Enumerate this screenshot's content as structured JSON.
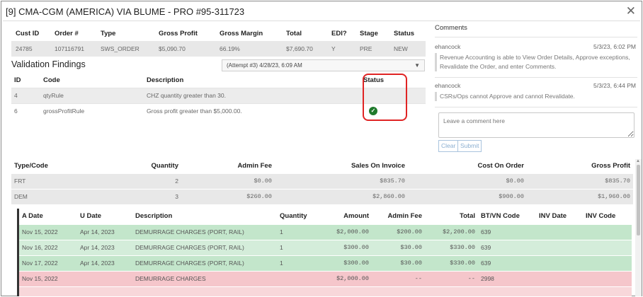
{
  "title": "[9] CMA-CGM (AMERICA) VIA BLUME - PRO #95-311723",
  "close_glyph": "✕",
  "order": {
    "headers": [
      "Cust ID",
      "Order #",
      "Type",
      "Gross Profit",
      "Gross Margin",
      "Total",
      "EDI?",
      "Stage",
      "Status"
    ],
    "row": [
      "24785",
      "107116791",
      "SWS_ORDER",
      "$5,090.70",
      "66.19%",
      "$7,690.70",
      "Y",
      "PRE",
      "NEW"
    ]
  },
  "validation": {
    "title": "Validation Findings",
    "attempt": "(Attempt #3) 4/28/23, 6:09 AM",
    "headers": [
      "ID",
      "Code",
      "Description",
      "Status"
    ],
    "rows": [
      {
        "id": "4",
        "code": "qtyRule",
        "description": "CHZ quantity greater than 30.",
        "status": ""
      },
      {
        "id": "6",
        "code": "grossProfitRule",
        "description": "Gross profit greater than $5,000.00.",
        "status": "check"
      }
    ]
  },
  "comments": {
    "title": "Comments",
    "items": [
      {
        "author": "ehancock",
        "time": "5/3/23, 6:02 PM",
        "text": "Revenue Accounting is able to View Order Details, Approve exceptions, Revalidate the Order, and enter Comments."
      },
      {
        "author": "ehancock",
        "time": "5/3/23, 6:44 PM",
        "text": "CSRs/Ops cannot Approve and cannot Revalidate."
      }
    ],
    "placeholder": "Leave a comment here",
    "clear_label": "Clear",
    "submit_label": "Submit"
  },
  "charges": {
    "headers": [
      "Type/Code",
      "Quantity",
      "Admin Fee",
      "Sales On Invoice",
      "Cost On Order",
      "Gross Profit"
    ],
    "rows": [
      [
        "FRT",
        "2",
        "$0.00",
        "$835.70",
        "$0.00",
        "$835.70"
      ],
      [
        "DEM",
        "3",
        "$260.00",
        "$2,860.00",
        "$900.00",
        "$1,960.00"
      ]
    ]
  },
  "details": {
    "headers": [
      "A Date",
      "U Date",
      "Description",
      "Quantity",
      "Amount",
      "Admin Fee",
      "Total",
      "BT/VN Code",
      "INV Date",
      "INV Code"
    ],
    "rows": [
      [
        "Nov 15, 2022",
        "Apr 14, 2023",
        "DEMURRAGE CHARGES (PORT, RAIL)",
        "1",
        "$2,000.00",
        "$200.00",
        "$2,200.00",
        "639",
        "",
        ""
      ],
      [
        "Nov 16, 2022",
        "Apr 14, 2023",
        "DEMURRAGE CHARGES (PORT, RAIL)",
        "1",
        "$300.00",
        "$30.00",
        "$330.00",
        "639",
        "",
        ""
      ],
      [
        "Nov 17, 2022",
        "Apr 14, 2023",
        "DEMURRAGE CHARGES (PORT, RAIL)",
        "1",
        "$300.00",
        "$30.00",
        "$330.00",
        "639",
        "",
        ""
      ],
      [
        "Nov 15, 2022",
        "",
        "DEMURRAGE CHARGES",
        "",
        "$2,000.00",
        "--",
        "--",
        "2998",
        "",
        ""
      ]
    ]
  },
  "colors": {
    "highlight": "#e02424",
    "profit_green": "#2e9d43",
    "row_green": "#c3e6cb",
    "row_red": "#f5c6cb",
    "check_green": "#1f7a2c"
  }
}
